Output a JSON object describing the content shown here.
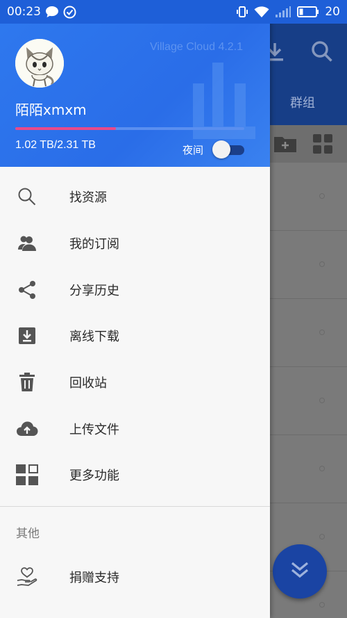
{
  "status_bar": {
    "time": "00:23",
    "battery": "20"
  },
  "drawer": {
    "app_version": "Village Cloud 4.2.1",
    "username": "陌陌xmxm",
    "storage_text": "1.02 TB/2.31 TB",
    "storage_used_fraction": 0.44,
    "night_mode_label": "夜间",
    "night_mode_on": false,
    "menu_items": [
      {
        "label": "找资源",
        "icon": "search-icon"
      },
      {
        "label": "我的订阅",
        "icon": "people-icon"
      },
      {
        "label": "分享历史",
        "icon": "share-icon"
      },
      {
        "label": "离线下载",
        "icon": "download-box-icon"
      },
      {
        "label": "回收站",
        "icon": "trash-icon"
      },
      {
        "label": "上传文件",
        "icon": "cloud-upload-icon"
      },
      {
        "label": "更多功能",
        "icon": "grid-icon"
      }
    ],
    "other_section_title": "其他",
    "other_items": [
      {
        "label": "捐赠支持",
        "icon": "heart-hand-icon"
      }
    ]
  },
  "background": {
    "tab_label": "群组"
  },
  "colors": {
    "header_blue": "#2e78ee",
    "status_blue": "#1e5fd8",
    "storage_fill": "#e84a8a",
    "fab": "#1a44a3"
  }
}
